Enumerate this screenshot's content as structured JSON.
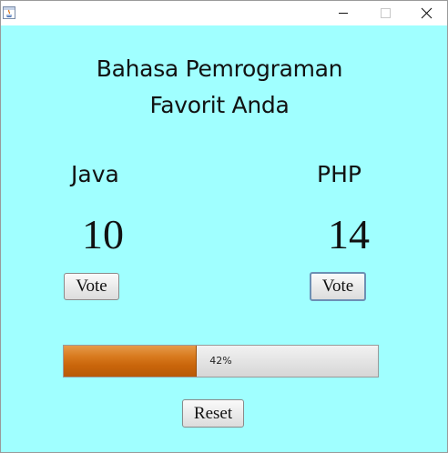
{
  "window": {
    "icon": "java-app-icon",
    "controls": [
      "minimize-icon",
      "maximize-icon",
      "close-icon"
    ]
  },
  "title": {
    "line1": "Bahasa Pemrograman",
    "line2": "Favorit Anda"
  },
  "candidates": [
    {
      "name": "Java",
      "votes": "10",
      "vote_label": "Vote"
    },
    {
      "name": "PHP",
      "votes": "14",
      "vote_label": "Vote"
    }
  ],
  "progress": {
    "value": 0.42,
    "label": "42%"
  },
  "reset_label": "Reset",
  "colors": {
    "background": "#a0ffff",
    "progress_fill": "#d87a1e"
  }
}
